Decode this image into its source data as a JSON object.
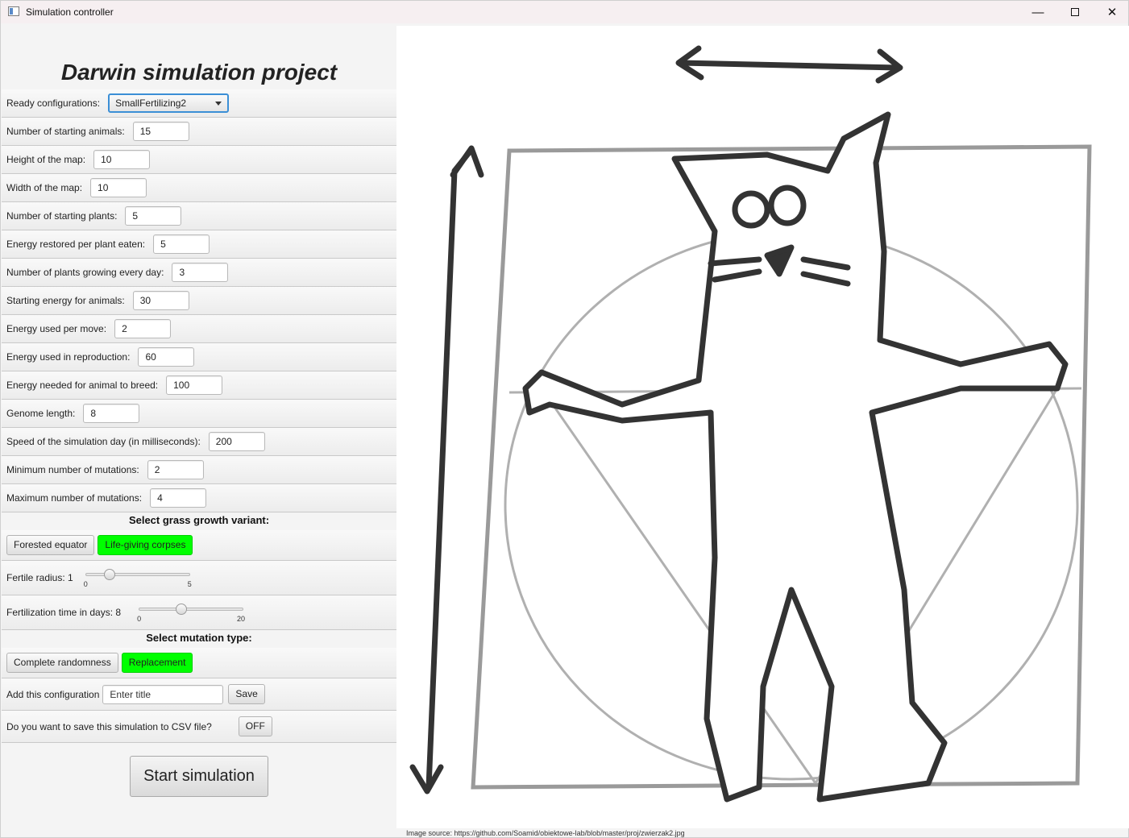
{
  "window": {
    "title": "Simulation controller",
    "controls": [
      "—",
      "□",
      "✕"
    ]
  },
  "heading": "Darwin simulation project",
  "ready_config": {
    "label": "Ready configurations:",
    "selected": "SmallFertilizing2"
  },
  "fields": [
    {
      "label": "Number of starting animals:",
      "value": "15"
    },
    {
      "label": "Height of the map:",
      "value": "10"
    },
    {
      "label": "Width of the map:",
      "value": "10"
    },
    {
      "label": "Number of starting plants:",
      "value": "5"
    },
    {
      "label": "Energy restored per plant eaten:",
      "value": "5"
    },
    {
      "label": "Number of plants growing every day:",
      "value": "3"
    },
    {
      "label": "Starting energy for animals:",
      "value": "30"
    },
    {
      "label": "Energy used per move:",
      "value": "2"
    },
    {
      "label": "Energy used in reproduction:",
      "value": "60"
    },
    {
      "label": "Energy needed for animal to breed:",
      "value": "100"
    },
    {
      "label": "Genome length:",
      "value": "8"
    },
    {
      "label": "Speed of the simulation day (in milliseconds):",
      "value": "200"
    },
    {
      "label": "Minimum number of mutations:",
      "value": "2"
    },
    {
      "label": "Maximum number of mutations:",
      "value": "4"
    }
  ],
  "grass": {
    "title": "Select grass growth variant:",
    "options": [
      "Forested equator",
      "Life-giving corpses"
    ],
    "selected": "Life-giving corpses"
  },
  "fertile_radius": {
    "label": "Fertile radius: 1",
    "min": "0",
    "max": "5",
    "value": 1
  },
  "fertilization_time": {
    "label": "Fertilization time in days: 8",
    "min": "0",
    "max": "20",
    "value": 8
  },
  "mutation": {
    "title": "Select mutation type:",
    "options": [
      "Complete randomness",
      "Replacement"
    ],
    "selected": "Replacement"
  },
  "add_config": {
    "label": "Add this configuration",
    "placeholder": "Enter title",
    "save_label": "Save"
  },
  "csv": {
    "label": "Do you want to save this simulation to CSV file?",
    "toggle_label": "OFF"
  },
  "start_label": "Start simulation",
  "image_source": "Image source:  https://github.com/Soamid/obiektowe-lab/blob/master/proj/zwierzak2.jpg",
  "colors": {
    "selected_green": "#00ff00",
    "combo_focus": "#3b8fd6"
  }
}
